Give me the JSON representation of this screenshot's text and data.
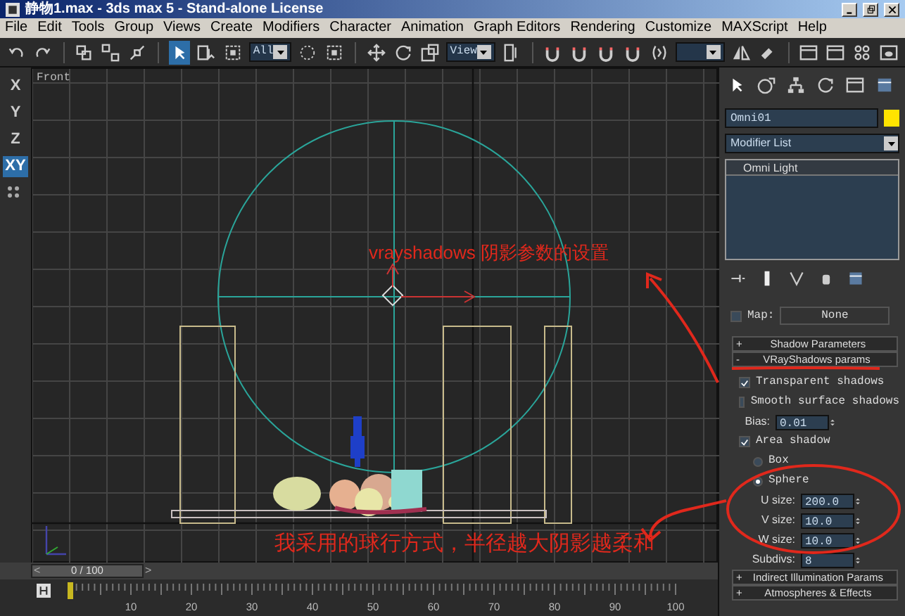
{
  "window": {
    "title": "静物1.max - 3ds max 5 - Stand-alone License"
  },
  "menu": [
    "File",
    "Edit",
    "Tools",
    "Group",
    "Views",
    "Create",
    "Modifiers",
    "Character",
    "Animation",
    "Graph Editors",
    "Rendering",
    "Customize",
    "MAXScript",
    "Help"
  ],
  "toolbar": {
    "buttons": [
      {
        "selected": false
      },
      {
        "selected": false
      },
      {
        "selected": false
      },
      {
        "selected": false
      },
      {
        "selected": false
      },
      {
        "selected": true
      },
      {
        "selected": false
      },
      {
        "selected": false
      },
      {
        "selected": false
      },
      {
        "selected": false
      },
      {
        "selected": false
      },
      {
        "selected": false
      },
      {
        "selected": false
      },
      {
        "selected": false
      },
      {
        "selected": false
      },
      {
        "selected": false
      },
      {
        "selected": false
      },
      {
        "selected": false
      },
      {
        "selected": false
      },
      {
        "selected": false
      },
      {
        "selected": false
      },
      {
        "selected": false
      },
      {
        "selected": false
      },
      {
        "selected": false
      },
      {
        "selected": false
      }
    ],
    "dropdowns": [
      "All",
      "View"
    ]
  },
  "axis_constraints": [
    {
      "label": "X",
      "selected": false
    },
    {
      "label": "Y",
      "selected": false
    },
    {
      "label": "Z",
      "selected": false
    },
    {
      "label": "XY",
      "selected": true
    }
  ],
  "viewport": {
    "label": "Front"
  },
  "annotations": [
    {
      "text": "vrayshadows 阴影参数的设置"
    },
    {
      "text": "我采用的球行方式，半径越大阴影越柔和"
    }
  ],
  "command_panel": {
    "object_name": "Omni01",
    "modifier_list": "Modifier List",
    "stack": [
      {
        "label": "Omni Light"
      }
    ],
    "map": {
      "checked": false,
      "label": "Map:",
      "button": "None"
    },
    "rollouts": [
      {
        "sign": "+",
        "title": "Shadow Parameters"
      },
      {
        "sign": "-",
        "title": "VRayShadows params",
        "params": [
          {
            "kind": "checkbox",
            "label": "Transparent shadows",
            "checked": true
          },
          {
            "kind": "checkbox",
            "label": "Smooth surface shadows",
            "checked": false
          },
          {
            "kind": "spinner",
            "label": "Bias:",
            "value": "0.01"
          },
          {
            "kind": "checkbox",
            "label": "Area shadow",
            "checked": true
          },
          {
            "kind": "radio",
            "label": "Box",
            "selected": false
          },
          {
            "kind": "radio",
            "label": "Sphere",
            "selected": true
          },
          {
            "kind": "spinner",
            "label": "U size:",
            "value": "200.0"
          },
          {
            "kind": "spinner",
            "label": "V size:",
            "value": "10.0"
          },
          {
            "kind": "spinner",
            "label": "W size:",
            "value": "10.0"
          },
          {
            "kind": "spinner",
            "label": "Subdivs:",
            "value": "8"
          }
        ]
      },
      {
        "sign": "+",
        "title": "Indirect Illumination Params"
      },
      {
        "sign": "+",
        "title": "Atmospheres & Effects"
      }
    ]
  },
  "time_slider": {
    "prev": "<",
    "label": "0 / 100",
    "next": ">",
    "level": 0
  },
  "ruler": {
    "ticks": [
      "10",
      "20",
      "30",
      "40",
      "50",
      "60",
      "70",
      "80",
      "90",
      "100"
    ]
  }
}
